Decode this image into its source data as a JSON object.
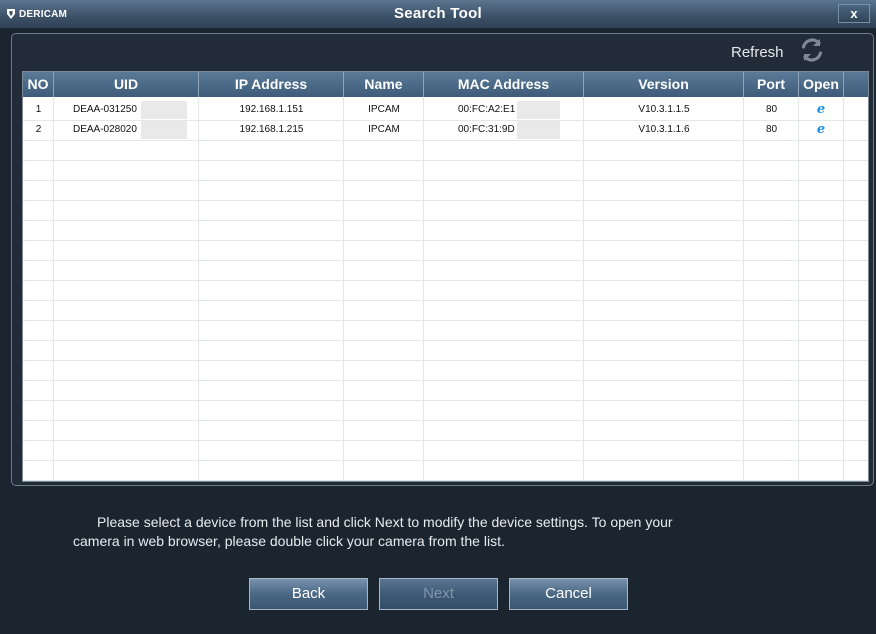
{
  "window": {
    "brand": "DERICAM",
    "title": "Search Tool",
    "close_label": "x"
  },
  "toolbar": {
    "refresh_label": "Refresh"
  },
  "table": {
    "headers": [
      "NO",
      "UID",
      "IP Address",
      "Name",
      "MAC Address",
      "Version",
      "Port",
      "Open"
    ],
    "rows": [
      {
        "no": "1",
        "uid": "DEAA-031250",
        "ip": "192.168.1.151",
        "name": "IPCAM",
        "mac": "00:FC:A2:E1",
        "version": "V10.3.1.1.5",
        "port": "80"
      },
      {
        "no": "2",
        "uid": "DEAA-028020",
        "ip": "192.168.1.215",
        "name": "IPCAM",
        "mac": "00:FC:31:9D",
        "version": "V10.3.1.1.6",
        "port": "80"
      }
    ],
    "open_icon": "ie-browser-icon"
  },
  "instructions": {
    "line1": "Please select a device from the list and click Next to modify the device settings. To open your",
    "line2": "camera in web browser, please double click your camera from the list."
  },
  "buttons": {
    "back": "Back",
    "next": "Next",
    "cancel": "Cancel"
  },
  "colors": {
    "title_bar": "#3d5369",
    "header": "#4a6a88",
    "ie_icon": "#1e8fe8"
  }
}
